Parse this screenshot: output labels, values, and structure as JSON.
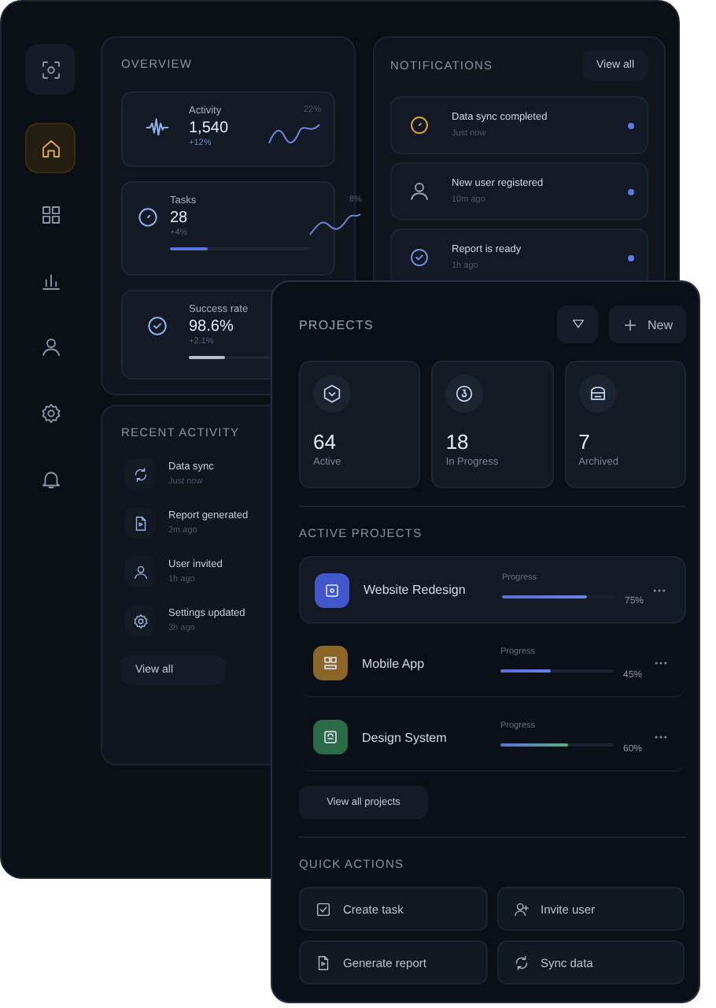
{
  "sidebar": {
    "logo": {
      "kind": "logo"
    },
    "items": [
      {
        "kind": "home",
        "selected": true
      },
      {
        "kind": "grid",
        "selected": false
      },
      {
        "kind": "chart",
        "selected": false
      },
      {
        "kind": "user",
        "selected": false
      },
      {
        "kind": "gear",
        "selected": false
      },
      {
        "kind": "bell",
        "selected": false
      }
    ]
  },
  "overview": {
    "title": "OVERVIEW",
    "cards": [
      {
        "kind": "wave",
        "label": "Activity",
        "value": "1,540",
        "change": "+12%",
        "percent": "22%",
        "trend": true
      },
      {
        "kind": "clock",
        "label": "Tasks",
        "value": "28",
        "change": "+4%",
        "percent": "8%",
        "trend": true,
        "level": 0.27,
        "color": "#5a73d8"
      },
      {
        "kind": "check",
        "label": "Success rate",
        "value": "98.6%",
        "change": "+2.1%",
        "level": 0.45,
        "color": "#b9bec8"
      }
    ]
  },
  "notifications": {
    "title": "NOTIFICATIONS",
    "button": "View all",
    "items": [
      {
        "kind": "clock",
        "title": "Data sync completed",
        "time": "Just now",
        "unread": true,
        "color": "#d9a640"
      },
      {
        "kind": "user",
        "title": "New user registered",
        "time": "10m ago",
        "unread": true,
        "color": "#9aa3b5"
      },
      {
        "kind": "check",
        "title": "Report is ready",
        "time": "1h ago",
        "unread": true,
        "color": "#6f8fd8"
      }
    ]
  },
  "recent_activity": {
    "title": "RECENT ACTIVITY",
    "button": "View all",
    "items": [
      {
        "kind": "sync",
        "title": "Data sync",
        "time": "Just now"
      },
      {
        "kind": "doc",
        "title": "Report generated",
        "time": "2m ago"
      },
      {
        "kind": "user",
        "title": "User invited",
        "time": "1h ago"
      },
      {
        "kind": "gear",
        "title": "Settings updated",
        "time": "3h ago"
      }
    ]
  },
  "projects": {
    "title": "PROJECTS",
    "new_button": "New",
    "stats": [
      {
        "kind": "hex",
        "value": "64",
        "label": "Active"
      },
      {
        "kind": "progress",
        "value": "18",
        "label": "In Progress"
      },
      {
        "kind": "archive",
        "value": "7",
        "label": "Archived"
      }
    ],
    "active_title": "ACTIVE PROJECTS",
    "rows": [
      {
        "name": "Website Redesign",
        "progress_label": "Progress",
        "level": 0.75,
        "reading": "75%",
        "color": "#4257c9",
        "selected": true
      },
      {
        "name": "Mobile App",
        "progress_label": "Progress",
        "level": 0.45,
        "reading": "45%",
        "color": "#8a6628",
        "selected": false
      },
      {
        "name": "Design System",
        "progress_label": "Progress",
        "level": 0.6,
        "reading": "60%",
        "color": "#2c6b4a",
        "selected": false
      }
    ],
    "view_all": "View all projects",
    "quick_title": "QUICK ACTIONS",
    "actions": [
      {
        "kind": "check",
        "label": "Create task"
      },
      {
        "kind": "adduser",
        "label": "Invite user"
      },
      {
        "kind": "doc",
        "label": "Generate report"
      },
      {
        "kind": "sync",
        "label": "Sync data"
      }
    ]
  }
}
